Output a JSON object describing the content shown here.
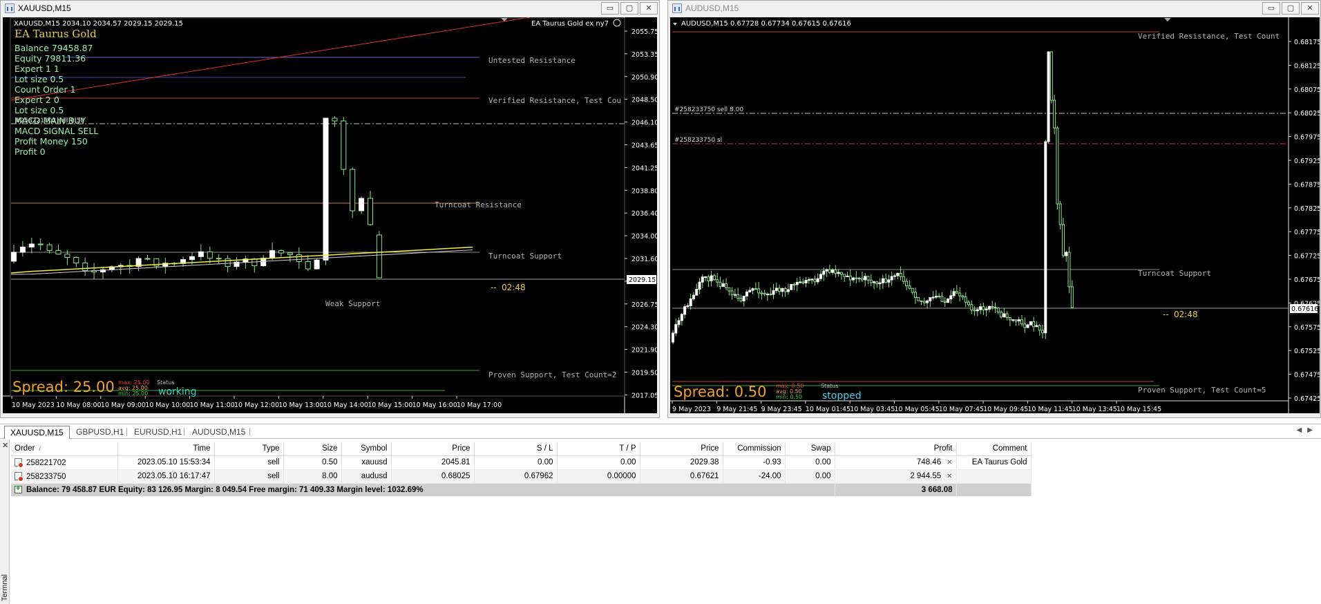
{
  "window_left": {
    "title": "XAUUSD,M15",
    "chart": {
      "header": "XAUUSD,M15  2034.10 2034.57 2029.15 2029.15",
      "ea_badge": "EA Taurus Gold ex ny7",
      "panel": {
        "ea_name": "EA Taurus Gold",
        "lines": [
          "Balance 79458.87",
          "Equity  79811.36",
          "Expert 1 1",
          "Lot size  0.5",
          "Count Order 1",
          "Expert 2  0",
          "Lot size  0.5",
          "MACD MAIN BUY",
          "MACD SIGNAL SELL",
          "Profit Money  150",
          "Profit   0"
        ],
        "order_label": "#258221702 sell 0.50"
      },
      "zones": [
        "Untested Resistance",
        "Verified Resistance, Test Cou",
        "Turncoat Resistance",
        "Turncoat Support",
        "Weak Support",
        "Proven Support, Test Count=2"
      ],
      "timer": "02:48",
      "price_axis": [
        "2055.75",
        "2053.35",
        "2050.90",
        "2048.50",
        "2046.10",
        "2043.65",
        "2041.25",
        "2038.80",
        "2036.40",
        "2034.00",
        "2031.60",
        "2029.15",
        "2026.75",
        "2024.30",
        "2021.90",
        "2019.50",
        "2017.05"
      ],
      "current_price": "2029.15",
      "time_axis": [
        "10 May 2023",
        "10 May 08:00",
        "10 May 09:00",
        "10 May 10:00",
        "10 May 11:00",
        "10 May 12:00",
        "10 May 13:00",
        "10 May 14:00",
        "10 May 15:00",
        "10 May 16:00",
        "10 May 17:00"
      ],
      "spread": {
        "label": "Spread: 25.00",
        "max": "max:  25.00",
        "avg": "avg:  25.00",
        "min": "min:  25.00",
        "status_label": "Status",
        "status": "working"
      }
    }
  },
  "window_right": {
    "title": "AUDUSD,M15",
    "chart": {
      "header": "AUDUSD,M15  0.67728 0.67734 0.67615 0.67616",
      "order_line": "#258233750 sell 8.00",
      "sl_line": "#258233750 sl",
      "zones": [
        "Verified Resistance, Test Count",
        "Turncoat Support",
        "Proven Support, Test Count=5"
      ],
      "timer": "02:48",
      "price_axis": [
        "0.68175",
        "0.68125",
        "0.68075",
        "0.68025",
        "0.67975",
        "0.67925",
        "0.67875",
        "0.67825",
        "0.67775",
        "0.67725",
        "0.67675",
        "0.67625",
        "0.67575",
        "0.67525",
        "0.67475",
        "0.67425"
      ],
      "current_price": "0.67616",
      "time_axis": [
        "9 May 2023",
        "9 May 21:45",
        "9 May 23:45",
        "10 May 01:45",
        "10 May 03:45",
        "10 May 05:45",
        "10 May 07:45",
        "10 May 09:45",
        "10 May 11:45",
        "10 May 13:45",
        "10 May 15:45"
      ],
      "spread": {
        "label": "Spread: 0.50",
        "max": "max:  0.50",
        "avg": "avg:  0.50",
        "min": "min:  0.50",
        "status_label": "Status",
        "status": "stopped"
      }
    }
  },
  "window_controls": {
    "minimize": "▭",
    "maximize": "▢",
    "close": "✕"
  },
  "tabs": [
    "XAUUSD,M15",
    "GBPUSD,H1",
    "EURUSD,H1",
    "AUDUSD,M15"
  ],
  "terminal": {
    "side_label": "Termnal",
    "columns": [
      "Order",
      "Time",
      "Type",
      "Size",
      "Symbol",
      "Price",
      "S / L",
      "T / P",
      "Price",
      "Commission",
      "Swap",
      "Profit",
      "Comment"
    ],
    "rows": [
      {
        "order": "258221702",
        "time": "2023.05.10 15:53:34",
        "type": "sell",
        "size": "0.50",
        "symbol": "xauusd",
        "price": "2045.81",
        "sl": "0.00",
        "tp": "0.00",
        "cur_price": "2029.38",
        "commission": "-0.93",
        "swap": "0.00",
        "profit": "748.46",
        "comment": "EA Taurus Gold"
      },
      {
        "order": "258233750",
        "time": "2023.05.10 16:17:47",
        "type": "sell",
        "size": "8.00",
        "symbol": "audusd",
        "price": "0.68025",
        "sl": "0.67962",
        "tp": "0.00000",
        "cur_price": "0.67621",
        "commission": "-24.00",
        "swap": "0.00",
        "profit": "2 944.55",
        "comment": ""
      }
    ],
    "summary": {
      "text": "Balance: 79 458.87 EUR  Equity: 83 126.95  Margin: 8 049.54  Free margin: 71 409.33  Margin level: 1032.69%",
      "total": "3 668.08"
    }
  },
  "colors": {
    "chart_bg": "#000000",
    "bull": "#ffffff",
    "bear_outline": "#8ee08e",
    "panel_text": "#9ff0b0",
    "ea_title": "#e8d048",
    "spread": "#f0a030",
    "status_working": "#3fd0c0",
    "status_stopped": "#3fd0f0",
    "zone_text": "#b0b0b0"
  }
}
